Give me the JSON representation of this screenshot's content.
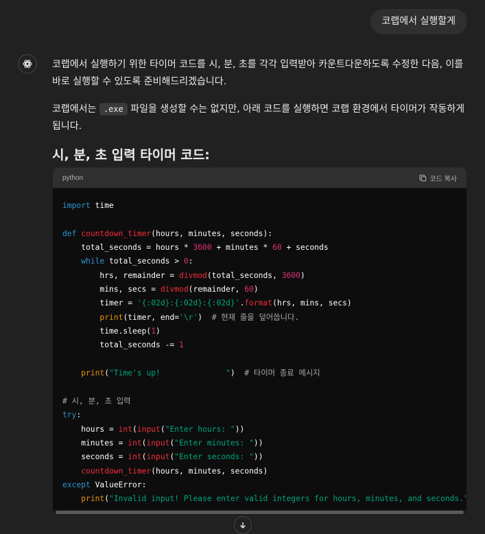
{
  "user_message": "코랩에서 실행할게",
  "assistant": {
    "paragraph1": "코랩에서 실행하기 위한 타이머 코드를 시, 분, 초를 각각 입력받아 카운트다운하도록 수정한 다음, 이를 바로 실행할 수 있도록 준비해드리겠습니다.",
    "paragraph2_pre": "코랩에서는 ",
    "paragraph2_code": ".exe",
    "paragraph2_post": " 파일을 생성할 수는 없지만, 아래 코드를 실행하면 코랩 환경에서 타이머가 작동하게 됩니다.",
    "heading": "시, 분, 초 입력 타이머 코드:"
  },
  "code_block": {
    "language": "python",
    "copy_label": "코드 복사",
    "lines": [
      "import time",
      "",
      "def countdown_timer(hours, minutes, seconds):",
      "    total_seconds = hours * 3600 + minutes * 60 + seconds",
      "    while total_seconds > 0:",
      "        hrs, remainder = divmod(total_seconds, 3600)",
      "        mins, secs = divmod(remainder, 60)",
      "        timer = '{:02d}:{:02d}:{:02d}'.format(hrs, mins, secs)",
      "        print(timer, end='\\r')  # 현재 줄을 덮어씁니다.",
      "        time.sleep(1)",
      "        total_seconds -= 1",
      "",
      "    print(\"Time's up!              \")  # 타이머 종료 메시지",
      "",
      "# 시, 분, 초 입력",
      "try:",
      "    hours = int(input(\"Enter hours: \"))",
      "    minutes = int(input(\"Enter minutes: \"))",
      "    seconds = int(input(\"Enter seconds: \"))",
      "    countdown_timer(hours, minutes, seconds)",
      "except ValueError:",
      "    print(\"Invalid input! Please enter valid integers for hours, minutes, and seconds.\")"
    ]
  },
  "icons": {
    "assistant_avatar": "openai-logo-icon",
    "copy": "copy-icon",
    "scroll_down": "arrow-down-icon"
  }
}
